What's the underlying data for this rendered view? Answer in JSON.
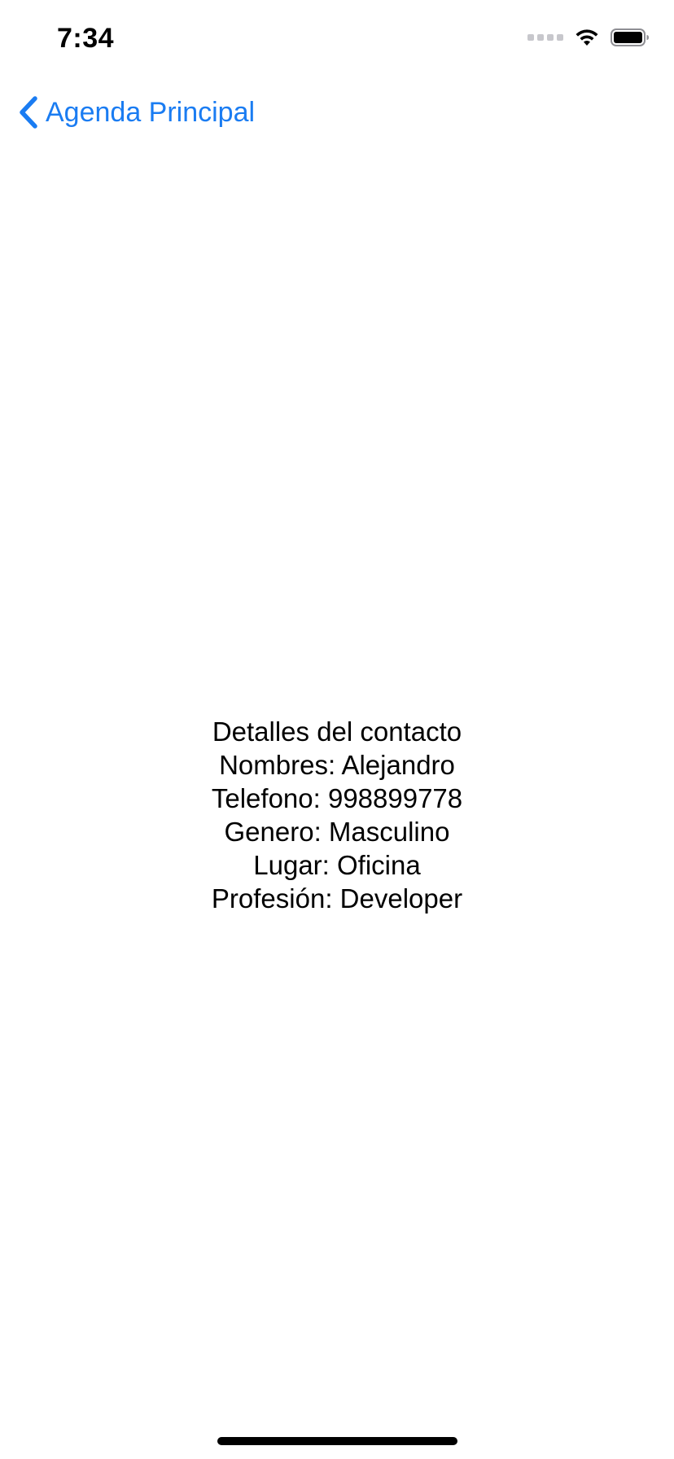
{
  "status_bar": {
    "time": "7:34",
    "icons": [
      "cellular-signal-icon",
      "wifi-icon",
      "battery-icon"
    ]
  },
  "nav": {
    "back_icon": "chevron-left-icon",
    "back_label": "Agenda Principal",
    "accent_color": "#1a7cf2"
  },
  "contact": {
    "heading": "Detalles del contacto",
    "name_line": "Nombres: Alejandro",
    "phone_line": "Telefono: 998899778",
    "gender_line": "Genero: Masculino",
    "place_line": "Lugar: Oficina",
    "profession_line": "Profesión: Developer"
  }
}
